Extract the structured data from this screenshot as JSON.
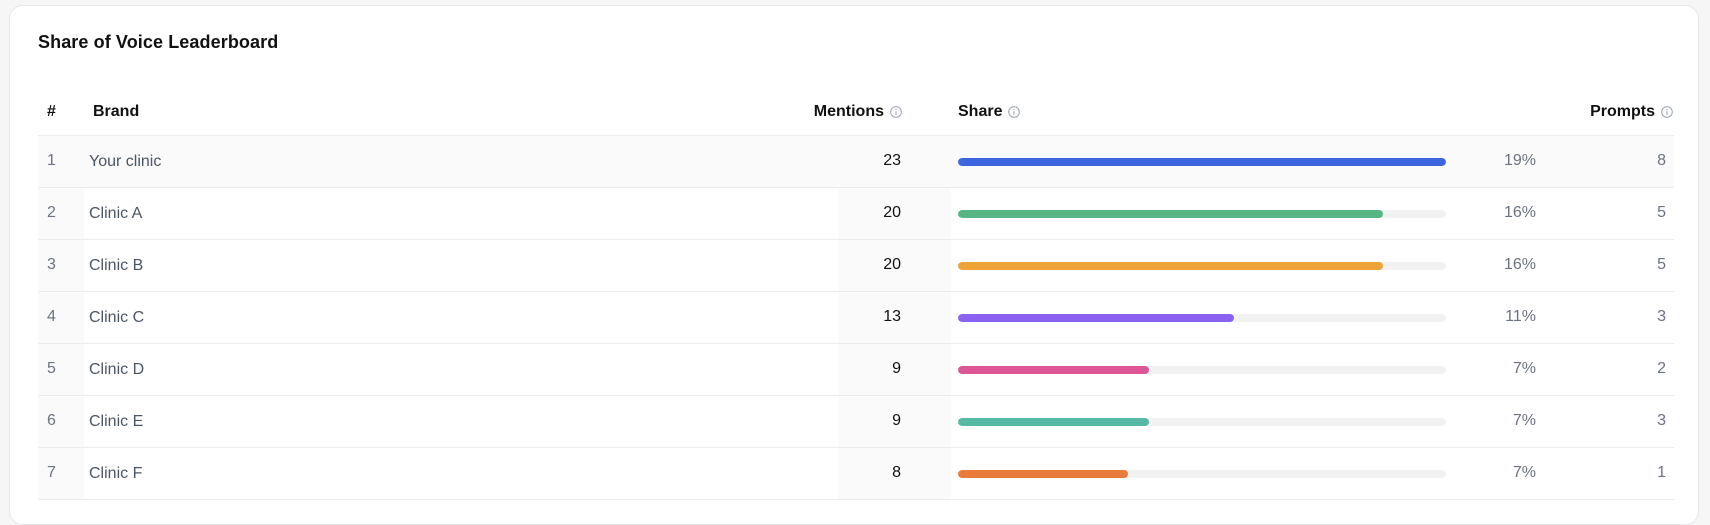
{
  "title": "Share of Voice Leaderboard",
  "columns": {
    "rank": "#",
    "brand": "Brand",
    "mentions": "Mentions",
    "share": "Share",
    "prompts": "Prompts"
  },
  "icons": {
    "info": "info-icon"
  },
  "rows": [
    {
      "rank": "1",
      "brand": "Your clinic",
      "mentions": "23",
      "share_fraction": 1.0,
      "share_label": "19%",
      "prompts": "8",
      "color": "#3b66e0"
    },
    {
      "rank": "2",
      "brand": "Clinic A",
      "mentions": "20",
      "share_fraction": 0.87,
      "share_label": "16%",
      "prompts": "5",
      "color": "#56b784"
    },
    {
      "rank": "3",
      "brand": "Clinic B",
      "mentions": "20",
      "share_fraction": 0.87,
      "share_label": "16%",
      "prompts": "5",
      "color": "#eea339"
    },
    {
      "rank": "4",
      "brand": "Clinic C",
      "mentions": "13",
      "share_fraction": 0.565,
      "share_label": "11%",
      "prompts": "3",
      "color": "#8b62ef"
    },
    {
      "rank": "5",
      "brand": "Clinic D",
      "mentions": "9",
      "share_fraction": 0.391,
      "share_label": "7%",
      "prompts": "2",
      "color": "#dc5696"
    },
    {
      "rank": "6",
      "brand": "Clinic E",
      "mentions": "9",
      "share_fraction": 0.391,
      "share_label": "7%",
      "prompts": "3",
      "color": "#56b9a6"
    },
    {
      "rank": "7",
      "brand": "Clinic F",
      "mentions": "8",
      "share_fraction": 0.348,
      "share_label": "7%",
      "prompts": "1",
      "color": "#ea7c3b"
    }
  ]
}
